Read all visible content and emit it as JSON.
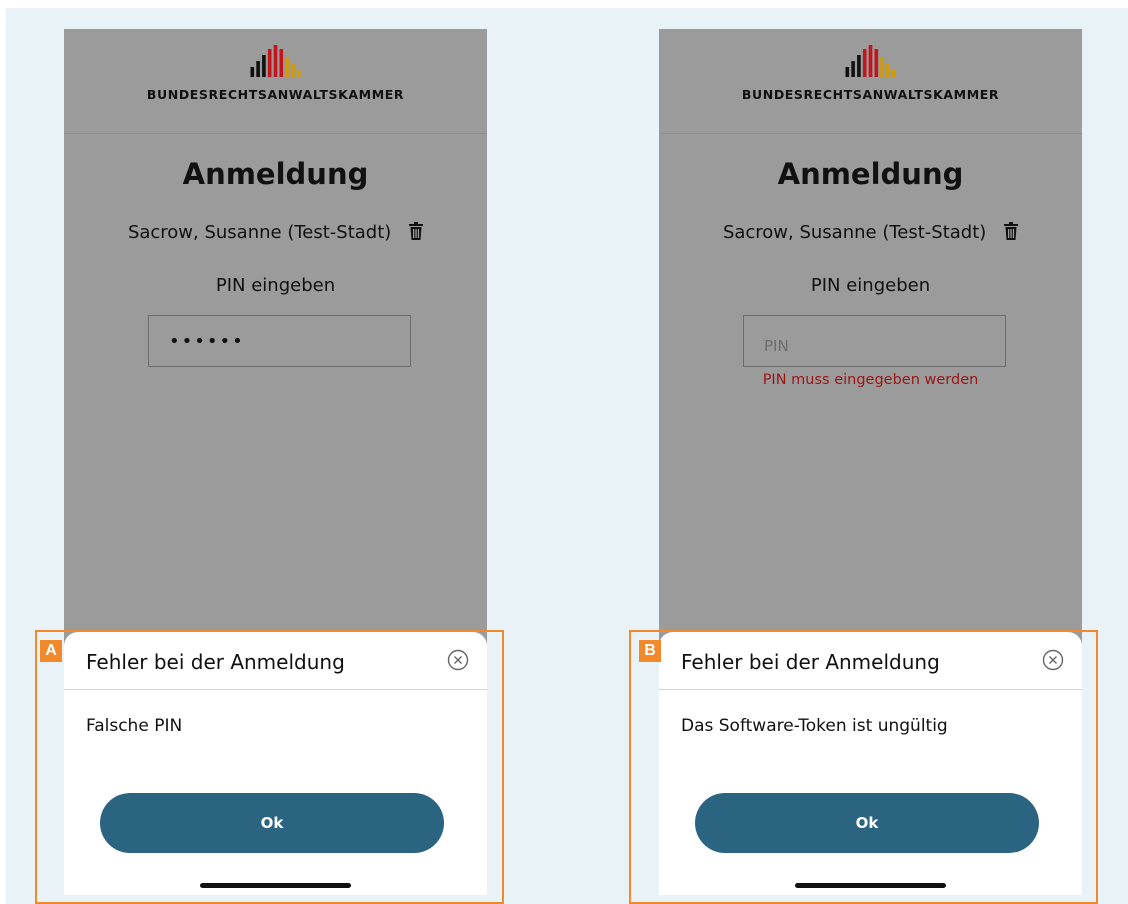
{
  "brand": {
    "name": "BUNDESRECHTSANWALTSKAMMER",
    "bar_colors": [
      "#111111",
      "#111111",
      "#111111",
      "#c4151c",
      "#c4151c",
      "#c4151c",
      "#d39b00",
      "#d39b00",
      "#d39b00"
    ]
  },
  "screens": [
    {
      "id": "A",
      "title": "Anmeldung",
      "user": "Sacrow, Susanne (Test-Stadt)",
      "pin_label": "PIN eingeben",
      "pin_value": "••••••",
      "pin_placeholder": "",
      "pin_error": "",
      "dialog": {
        "title": "Fehler bei der Anmeldung",
        "message": "Falsche PIN",
        "ok_label": "Ok"
      }
    },
    {
      "id": "B",
      "title": "Anmeldung",
      "user": "Sacrow, Susanne (Test-Stadt)",
      "pin_label": "PIN eingeben",
      "pin_value": "",
      "pin_placeholder": "PIN",
      "pin_error": "PIN muss eingegeben werden",
      "dialog": {
        "title": "Fehler bei der Anmeldung",
        "message": "Das Software-Token ist ungültig",
        "ok_label": "Ok"
      }
    }
  ],
  "colors": {
    "accent_button": "#2b6480",
    "error_text": "#9b1515",
    "callout_frame": "#f28a2c",
    "overlay_gray": "#9b9b9b"
  }
}
